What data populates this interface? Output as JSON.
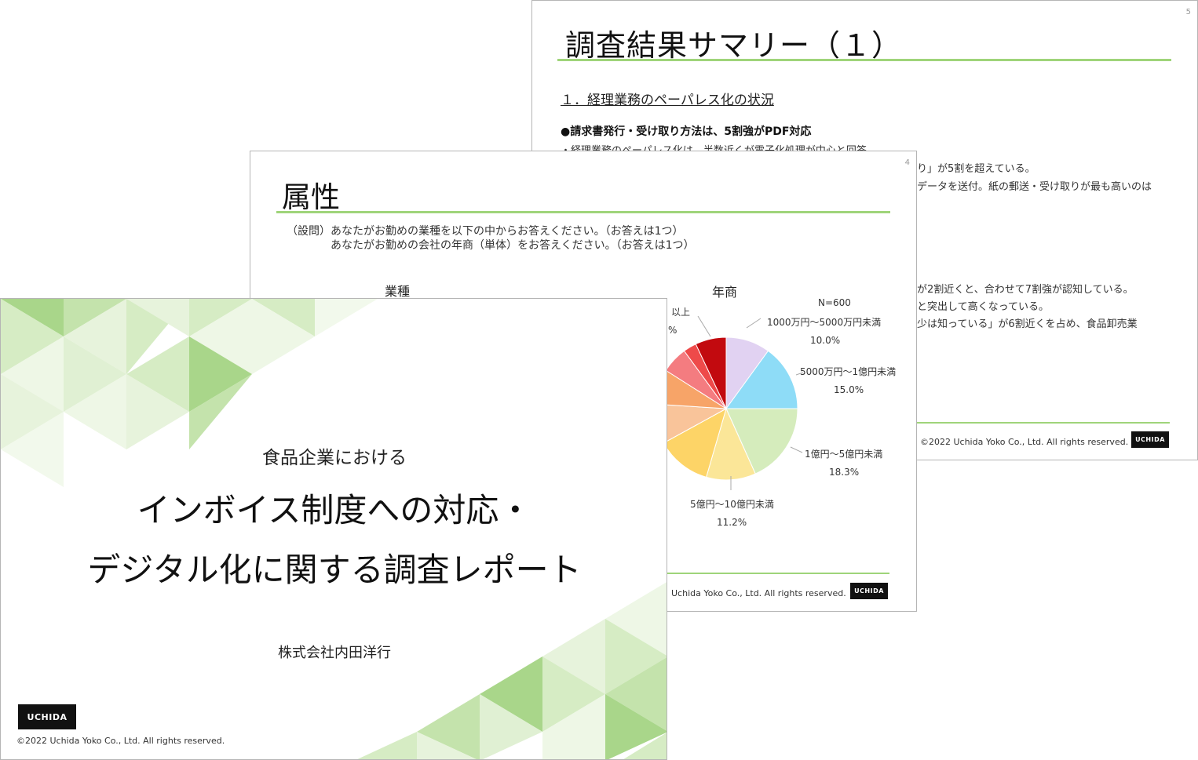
{
  "slide5": {
    "page_number": "5",
    "title": "調査結果サマリー（１）",
    "subtitle": "１．経理業務のペーパレス化の状況",
    "bullet": "●請求書発行・受け取り方法は、5割強がPDF対応",
    "lines": [
      "・経理業務のペーパレス化は、半数近くが電子化処理が中心と回答。",
      "り」が5割を超えている。",
      "データを送付。紙の郵送・受け取りが最も高いのは",
      "が2割近くと、合わせて7割強が認知している。",
      "と突出して高くなっている。",
      "少は知っている」が6割近くを占め、食品卸売業"
    ],
    "copyright": "©2022  Uchida  Yoko Co., Ltd. All rights reserved.",
    "logo": "UCHIDA"
  },
  "slide4": {
    "page_number": "4",
    "title": "属性",
    "question_line1": "（設問）あなたがお勤めの業種を以下の中からお答えください。（お答えは1つ）",
    "question_line2": "あなたがお勤めの会社の年商（単体）をお答えください。（お答えは1つ）",
    "chart_left_title": "業種",
    "copyright": "Uchida  Yoko Co., Ltd. All rights reserved.",
    "logo": "UCHIDA"
  },
  "chart_data": {
    "type": "pie",
    "title": "年商",
    "annotation": "N=600",
    "slices": [
      {
        "label": "1000万円～5000万円未満",
        "value": 10.0,
        "display": "10.0%",
        "color": "#e1d2f2"
      },
      {
        "label": "5000万円～1億円未満",
        "value": 15.0,
        "display": "15.0%",
        "color": "#8edcf7"
      },
      {
        "label": "1億円～5億円未満",
        "value": 18.3,
        "display": "18.3%",
        "color": "#d5ecbc"
      },
      {
        "label": "5億円～10億円未満",
        "value": 11.2,
        "display": "11.2%",
        "color": "#fbe698"
      },
      {
        "label": "",
        "value": 12.5,
        "display": "",
        "color": "#fdd467"
      },
      {
        "label": "",
        "value": 9.0,
        "display": "",
        "color": "#f9c49a"
      },
      {
        "label": "",
        "value": 8.0,
        "display": "",
        "color": "#f7a468"
      },
      {
        "label": "",
        "value": 6.0,
        "display": "",
        "color": "#f47c80"
      },
      {
        "label": "",
        "value": 3.0,
        "display": "",
        "color": "#ee4a4a"
      },
      {
        "label": "以上",
        "value": 7.0,
        "display": "%",
        "color": "#c20a0f"
      }
    ]
  },
  "slide3": {
    "pretitle": "食品企業における",
    "title_line1": "インボイス制度への対応・",
    "title_line2": "デジタル化に関する調査レポート",
    "company": "株式会社内田洋行",
    "copyright": "©2022  Uchida  Yoko Co., Ltd. All rights reserved.",
    "logo": "UCHIDA"
  }
}
